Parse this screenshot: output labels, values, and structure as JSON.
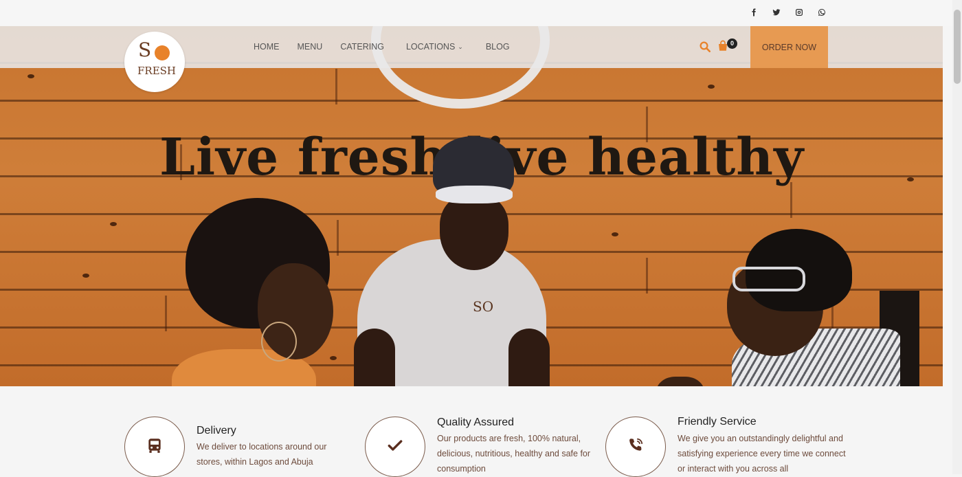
{
  "social": {
    "icons": [
      "facebook-icon",
      "twitter-icon",
      "instagram-icon",
      "whatsapp-icon"
    ]
  },
  "brand": {
    "logo_top": "S",
    "logo_bottom": "FRESH",
    "accent": "#e79a52",
    "text_brown": "#6d4b3c"
  },
  "nav": {
    "items": [
      "HOME",
      "MENU",
      "CATERING",
      "LOCATIONS",
      "BLOG"
    ],
    "cart_count": "0",
    "order_button": "ORDER NOW"
  },
  "hero": {
    "slogan": "Live fresh live healthy",
    "shirt_logo": "SO"
  },
  "features": [
    {
      "icon": "delivery-bus-icon",
      "title": "Delivery",
      "description": "We deliver to locations around our stores, within Lagos and Abuja"
    },
    {
      "icon": "checkmark-icon",
      "title": "Quality Assured",
      "description": "Our products are fresh, 100% natural, delicious, nutritious, healthy and safe for consumption"
    },
    {
      "icon": "phone-icon",
      "title": "Friendly Service",
      "description": "We give you an outstandingly delightful and satisfying experience every time we connect or interact with you across all"
    }
  ]
}
